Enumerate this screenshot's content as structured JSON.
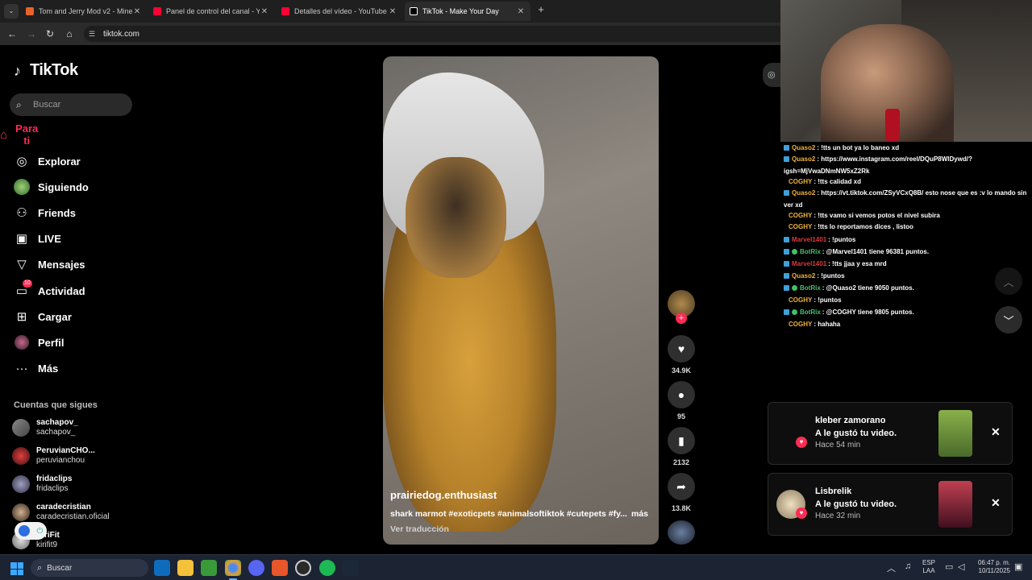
{
  "browser": {
    "tabs": [
      {
        "title": "Tom and Jerry Mod v2 - Minecraft",
        "color": "#e8632b"
      },
      {
        "title": "Panel de control del canal - YouTube",
        "color": "#ff0033"
      },
      {
        "title": "Detalles del vídeo - YouTube Studio",
        "color": "#ff0033"
      },
      {
        "title": "TikTok - Make Your Day",
        "color": "#ffffff"
      }
    ],
    "url": "tiktok.com"
  },
  "sidebar": {
    "logo": "TikTok",
    "search_placeholder": "Buscar",
    "menu": [
      {
        "label": "Para ti",
        "icon": "home-icon"
      },
      {
        "label": "Explorar",
        "icon": "compass-icon"
      },
      {
        "label": "Siguiendo",
        "icon": "following-avatar-icon"
      },
      {
        "label": "Friends",
        "icon": "friends-icon"
      },
      {
        "label": "LIVE",
        "icon": "live-tv-icon"
      },
      {
        "label": "Mensajes",
        "icon": "send-icon"
      },
      {
        "label": "Actividad",
        "icon": "inbox-icon",
        "badge": "10"
      },
      {
        "label": "Cargar",
        "icon": "upload-icon"
      },
      {
        "label": "Perfil",
        "icon": "profile-avatar-icon"
      },
      {
        "label": "Más",
        "icon": "more-icon"
      }
    ],
    "following_title": "Cuentas que sigues",
    "following": [
      {
        "name": "sachapov_",
        "handle": "sachapov_"
      },
      {
        "name": "PeruvianCHO...",
        "handle": "peruvianchou"
      },
      {
        "name": "fridaclips",
        "handle": "fridaclips"
      },
      {
        "name": "caradecristian",
        "handle": "caradecristian.oficial"
      },
      {
        "name": "KiriFit",
        "handle": "kirifit9"
      }
    ]
  },
  "video": {
    "author": "prairiedog.enthusiast",
    "description": "shark marmot #exoticpets #animalsoftiktok #cutepets #fy...",
    "more": "más",
    "translate": "Ver traducción",
    "likes": "34.9K",
    "comments": "95",
    "saves": "2132",
    "shares": "13.8K"
  },
  "chat": [
    {
      "user": "Quaso2",
      "color": "#f0b43a",
      "text": ": !tts un bot ya lo baneo xd",
      "badge": "twitch"
    },
    {
      "user": "Quaso2",
      "color": "#f0b43a",
      "text": ": https://www.instagram.com/reel/DQuP8WlDywd/?igsh=MjVwaDNmNW5xZ2Rk",
      "badge": "twitch"
    },
    {
      "user": "COGHY",
      "color": "#f0b43a",
      "text": ": !tts calidad xd",
      "badge": ""
    },
    {
      "user": "Quaso2",
      "color": "#f0b43a",
      "text": ": https://vt.tiktok.com/ZSyVCxQ8B/ esto nose que es :v lo mando sin ver xd",
      "badge": "twitch"
    },
    {
      "user": "COGHY",
      "color": "#f0b43a",
      "text": ": !tts vamo si vemos potos el nivel subira",
      "badge": ""
    },
    {
      "user": "COGHY",
      "color": "#f0b43a",
      "text": ": !tts lo reportamos dices , listoo",
      "badge": ""
    },
    {
      "user": "Marvel1401",
      "color": "#e0383b",
      "text": ": !puntos",
      "badge": "twitch"
    },
    {
      "user": "BotRix",
      "color": "#46c26a",
      "text": ": @Marvel1401 tiene 96381 puntos.",
      "badge": "bot"
    },
    {
      "user": "Marvel1401",
      "color": "#e0383b",
      "text": ": !tts jjaa y esa mrd",
      "badge": "twitch"
    },
    {
      "user": "Quaso2",
      "color": "#f0b43a",
      "text": ": !puntos",
      "badge": "twitch"
    },
    {
      "user": "BotRix",
      "color": "#46c26a",
      "text": ": @Quaso2 tiene 9050 puntos.",
      "badge": "bot"
    },
    {
      "user": "COGHY",
      "color": "#f0b43a",
      "text": ": !puntos",
      "badge": ""
    },
    {
      "user": "BotRix",
      "color": "#46c26a",
      "text": ": @COGHY tiene 9805 puntos.",
      "badge": "bot"
    },
    {
      "user": "COGHY",
      "color": "#f0b43a",
      "text": ": hahaha",
      "badge": ""
    }
  ],
  "notifications": [
    {
      "name": "kleber zamorano",
      "message": "A le gustó tu video.",
      "time": "Hace 54 min"
    },
    {
      "name": "Lisbrelik",
      "message": "A le gustó tu video.",
      "time": "Hace 32 min"
    }
  ],
  "taskbar": {
    "search_placeholder": "Buscar",
    "lang_1": "ESP",
    "lang_2": "LAA",
    "time": "06:47 p. m.",
    "date": "10/11/2025"
  },
  "colors": {
    "accent": "#fe2c55",
    "chrome_bg": "#1f1f1f",
    "taskbar_bg": "#1c2333"
  }
}
